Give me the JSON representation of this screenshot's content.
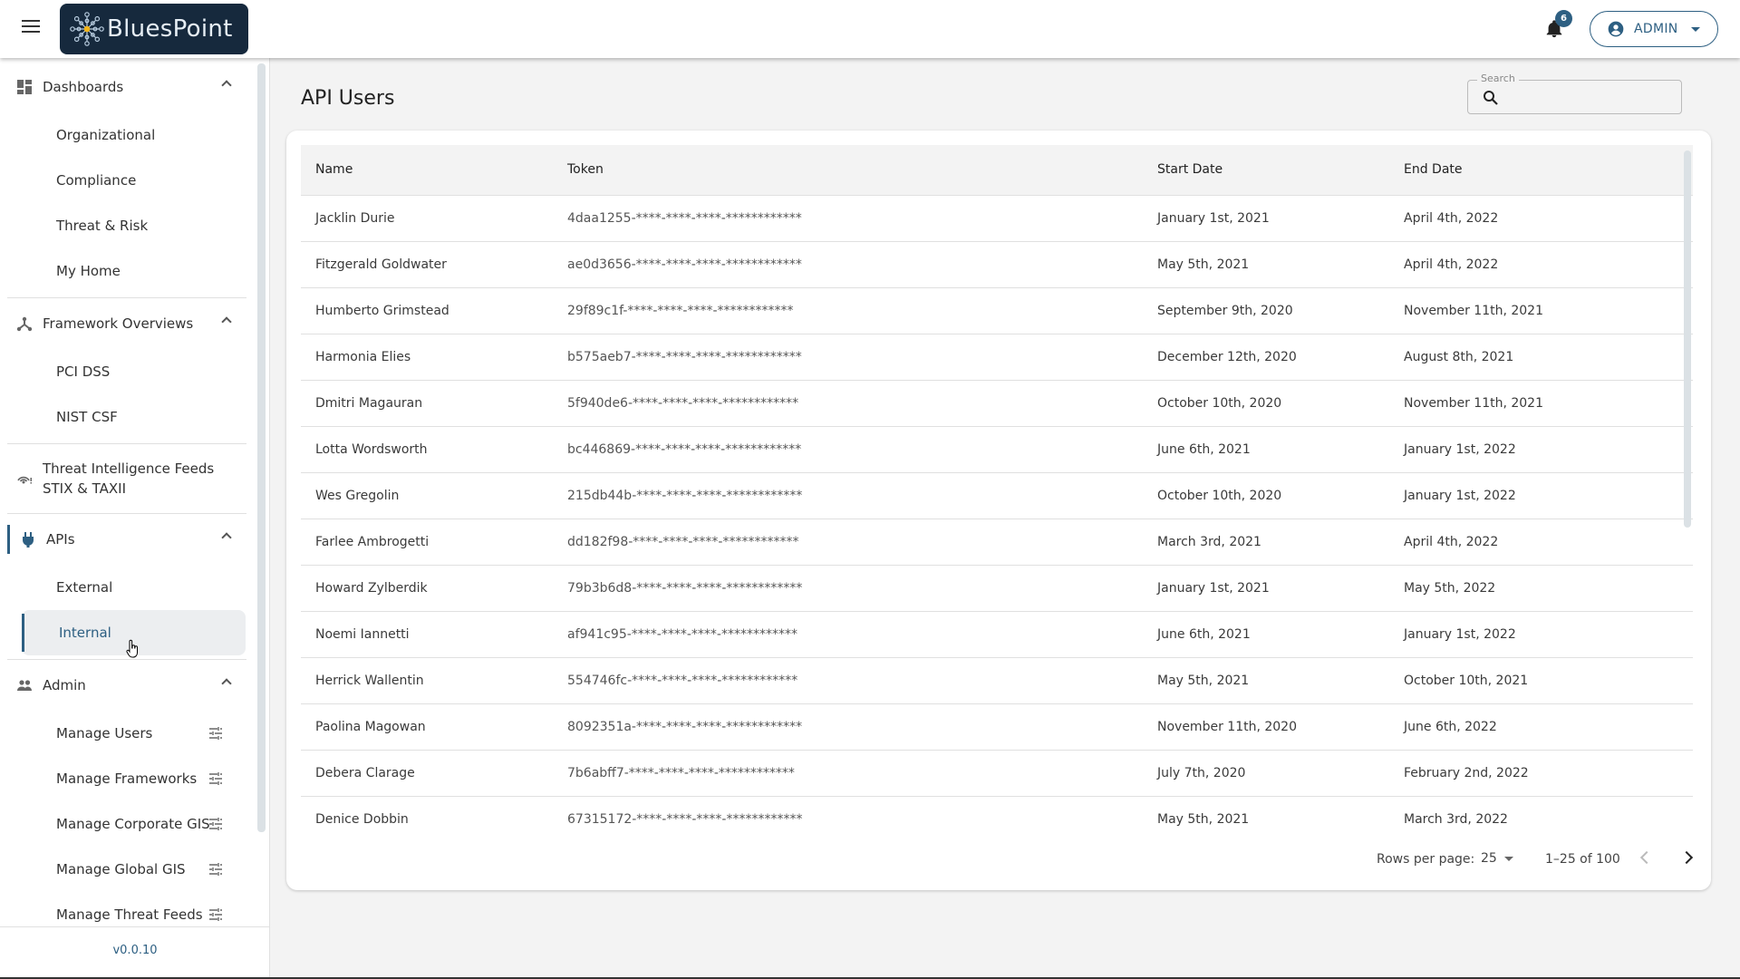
{
  "header": {
    "app_name": "BluesPoint",
    "notification_count": "6",
    "user_label": "ADMIN",
    "accent_color": "#2d5f82",
    "logo_bg": "#16293d"
  },
  "sidebar": {
    "groups": [
      {
        "label": "Dashboards",
        "icon": "dashboard-icon",
        "items": [
          "Organizational",
          "Compliance",
          "Threat & Risk",
          "My Home"
        ]
      },
      {
        "label": "Framework Overviews",
        "icon": "hub-icon",
        "items": [
          "PCI DSS",
          "NIST CSF"
        ]
      },
      {
        "label": "Threat Intelligence Feeds",
        "label_line2": "STIX & TAXII",
        "icon": "wifi-alert-icon"
      },
      {
        "label": "APIs",
        "icon": "plug-icon",
        "items": [
          "External",
          "Internal"
        ],
        "active_item": "Internal"
      },
      {
        "label": "Admin",
        "icon": "users-icon",
        "items": [
          "Manage Users",
          "Manage Frameworks",
          "Manage Corporate GIS",
          "Manage Global GIS",
          "Manage Threat Feeds"
        ]
      }
    ],
    "version": "v0.0.10"
  },
  "main": {
    "title": "API Users",
    "search": {
      "label": "Search",
      "value": ""
    },
    "table": {
      "columns": [
        "Name",
        "Token",
        "Start Date",
        "End Date"
      ],
      "rows": [
        [
          "Jacklin Durie",
          "4daa1255-****-****-****-************",
          "January 1st, 2021",
          "April 4th, 2022"
        ],
        [
          "Fitzgerald Goldwater",
          "ae0d3656-****-****-****-************",
          "May 5th, 2021",
          "April 4th, 2022"
        ],
        [
          "Humberto Grimstead",
          "29f89c1f-****-****-****-************",
          "September 9th, 2020",
          "November 11th, 2021"
        ],
        [
          "Harmonia Elies",
          "b575aeb7-****-****-****-************",
          "December 12th, 2020",
          "August 8th, 2021"
        ],
        [
          "Dmitri Magauran",
          "5f940de6-****-****-****-************",
          "October 10th, 2020",
          "November 11th, 2021"
        ],
        [
          "Lotta Wordsworth",
          "bc446869-****-****-****-************",
          "June 6th, 2021",
          "January 1st, 2022"
        ],
        [
          "Wes Gregolin",
          "215db44b-****-****-****-************",
          "October 10th, 2020",
          "January 1st, 2022"
        ],
        [
          "Farlee Ambrogetti",
          "dd182f98-****-****-****-************",
          "March 3rd, 2021",
          "April 4th, 2022"
        ],
        [
          "Howard Zylberdik",
          "79b3b6d8-****-****-****-************",
          "January 1st, 2021",
          "May 5th, 2022"
        ],
        [
          "Noemi Iannetti",
          "af941c95-****-****-****-************",
          "June 6th, 2021",
          "January 1st, 2022"
        ],
        [
          "Herrick Wallentin",
          "554746fc-****-****-****-************",
          "May 5th, 2021",
          "October 10th, 2021"
        ],
        [
          "Paolina Magowan",
          "8092351a-****-****-****-************",
          "November 11th, 2020",
          "June 6th, 2022"
        ],
        [
          "Debera Clarage",
          "7b6abff7-****-****-****-************",
          "July 7th, 2020",
          "February 2nd, 2022"
        ],
        [
          "Denice Dobbin",
          "67315172-****-****-****-************",
          "May 5th, 2021",
          "March 3rd, 2022"
        ]
      ]
    },
    "pagination": {
      "rows_per_page_label": "Rows per page:",
      "rows_per_page": "25",
      "range": "1–25 of 100"
    }
  }
}
